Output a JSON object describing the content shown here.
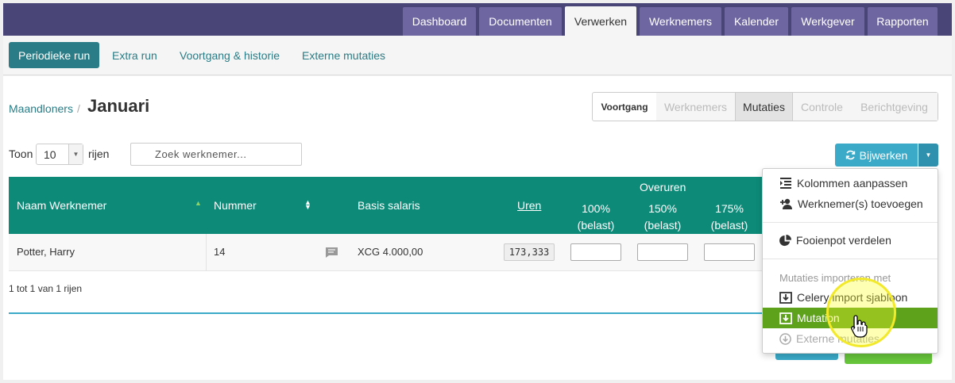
{
  "topnav": {
    "tabs": [
      "Dashboard",
      "Documenten",
      "Verwerken",
      "Werknemers",
      "Kalender",
      "Werkgever",
      "Rapporten"
    ],
    "active": "Verwerken"
  },
  "subnav": {
    "items": [
      "Periodieke run",
      "Extra run",
      "Voortgang & historie",
      "Externe mutaties"
    ],
    "active": "Periodieke run"
  },
  "breadcrumb": {
    "parent": "Maandloners",
    "separator": "/"
  },
  "page_title": "Januari",
  "steps": [
    "Voortgang",
    "Werknemers",
    "Mutaties",
    "Controle",
    "Berichtgeving"
  ],
  "steps_current": "Mutaties",
  "table_controls": {
    "show_label": "Toon",
    "page_size": "10",
    "rows_label": "rijen",
    "search_placeholder": "Zoek werknemer..."
  },
  "update_button": {
    "label": "Bijwerken"
  },
  "table": {
    "columns": {
      "name": "Naam Werknemer",
      "number": "Nummer",
      "base_salary": "Basis salaris",
      "hours": "Uren",
      "overtime_group": "Overuren",
      "ot100": "100% (belast)",
      "ot150": "150% (belast)",
      "ot175": "175% (belast)"
    },
    "rows": [
      {
        "name": "Potter, Harry",
        "number": "14",
        "salary": "XCG 4.000,00",
        "hours": "173,333"
      }
    ],
    "info": "1 tot 1 van 1 rijen"
  },
  "dropdown": {
    "items": [
      {
        "label": "Kolommen aanpassen",
        "icon": "columns-indent-icon"
      },
      {
        "label": "Werknemer(s) toevoegen",
        "icon": "user-plus-icon"
      },
      {
        "label": "Fooienpot verdelen",
        "icon": "pie-chart-icon"
      }
    ],
    "import_header": "Mutaties importeren met",
    "import_items": [
      {
        "label": "Celery import sjabloon",
        "icon": "download-box-icon"
      },
      {
        "label": "Mutation",
        "icon": "download-box-icon",
        "selected": true
      },
      {
        "label": "Externe mutaties",
        "icon": "download-circle-icon",
        "disabled": true
      }
    ]
  },
  "colors": {
    "nav_bg": "#4a4577",
    "nav_tab": "#6e66a0",
    "teal": "#2a7d86",
    "table_header": "#0d8a78",
    "button_blue": "#3aaac8",
    "selected_green": "#5ea21c"
  }
}
